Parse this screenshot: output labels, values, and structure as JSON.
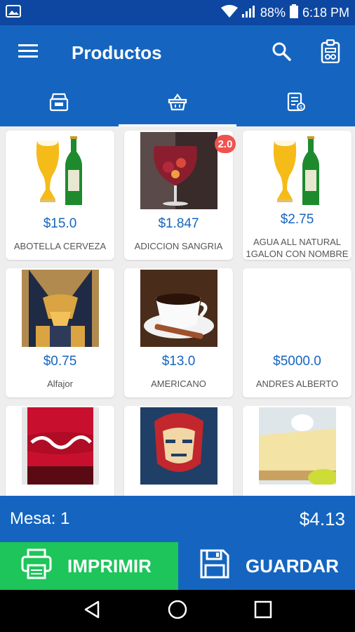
{
  "status_bar": {
    "battery": "88%",
    "time": "6:18 PM"
  },
  "app_bar": {
    "title": "Productos"
  },
  "tabs": [
    {
      "icon": "cash-register-icon"
    },
    {
      "icon": "basket-icon",
      "active": true
    },
    {
      "icon": "receipt-icon"
    }
  ],
  "products": [
    {
      "price": "$15.0",
      "name": "ABOTELLA CERVEZA",
      "image": "beer"
    },
    {
      "price": "$1.847",
      "name": "ADICCION SANGRIA",
      "image": "sangria",
      "badge": "2.0"
    },
    {
      "price": "$2.75",
      "name": "AGUA ALL NATURAL 1GALON CON NOMBRE",
      "image": "beer"
    },
    {
      "price": "$0.75",
      "name": "Alfajor",
      "image": "wolverine"
    },
    {
      "price": "$13.0",
      "name": "AMERICANO",
      "image": "coffee"
    },
    {
      "price": "$5000.0",
      "name": "ANDRES ALBERTO",
      "image": ""
    },
    {
      "price": "",
      "name": "",
      "image": "cola"
    },
    {
      "price": "",
      "name": "",
      "image": "ironman"
    },
    {
      "price": "",
      "name": "",
      "image": "pie"
    }
  ],
  "footer": {
    "mesa": "Mesa: 1",
    "total": "$4.13"
  },
  "actions": {
    "print_label": "IMPRIMIR",
    "save_label": "GUARDAR"
  },
  "colors": {
    "primary": "#1565c0",
    "primary_dark": "#0d47a1",
    "print_green": "#1dc55a",
    "badge_red": "#ef5350"
  }
}
